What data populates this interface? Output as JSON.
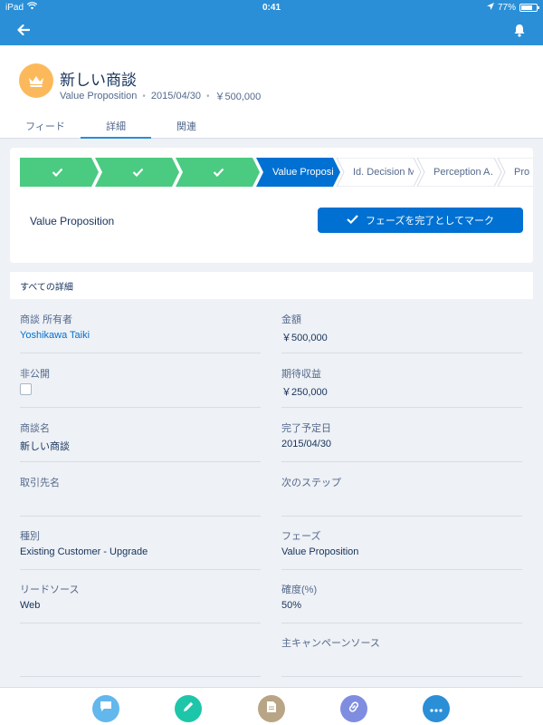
{
  "status_bar": {
    "device": "iPad",
    "time": "0:41",
    "battery": "77%",
    "battery_level": 0.77
  },
  "nav": {
    "back_icon": "arrow-left-icon",
    "bell_icon": "bell-icon"
  },
  "record": {
    "icon": "crown-icon",
    "icon_color": "#fcb95b",
    "title": "新しい商談",
    "stage": "Value Proposition",
    "close_date": "2015/04/30",
    "amount": "￥500,000"
  },
  "tabs": [
    {
      "label": "フィード",
      "active": false
    },
    {
      "label": "詳細",
      "active": true
    },
    {
      "label": "関連",
      "active": false
    }
  ],
  "path": {
    "stages": [
      {
        "label": "",
        "state": "complete"
      },
      {
        "label": "",
        "state": "complete"
      },
      {
        "label": "",
        "state": "complete"
      },
      {
        "label": "Value Proposi…",
        "state": "current"
      },
      {
        "label": "Id. Decision M…",
        "state": "incomplete"
      },
      {
        "label": "Perception A…",
        "state": "incomplete"
      },
      {
        "label": "Pro",
        "state": "incomplete"
      }
    ],
    "colors": {
      "complete": "#4bca81",
      "current": "#0070d2",
      "incomplete": "#ffffff"
    },
    "current_stage_name": "Value Proposition",
    "mark_button_label": "フェーズを完了としてマーク"
  },
  "details": {
    "section_title": "すべての詳細",
    "owner_label": "商談 所有者",
    "owner_value": "Yoshikawa Taiki",
    "amount_label": "金額",
    "amount_value": "￥500,000",
    "private_label": "非公開",
    "expected_label": "期待収益",
    "expected_value": "￥250,000",
    "name_label": "商談名",
    "name_value": "新しい商談",
    "close_label": "完了予定日",
    "close_value": "2015/04/30",
    "account_label": "取引先名",
    "account_value": "",
    "next_step_label": "次のステップ",
    "next_step_value": "",
    "type_label": "種別",
    "type_value": "Existing Customer - Upgrade",
    "stage_label": "フェーズ",
    "stage_value": "Value Proposition",
    "lead_label": "リードソース",
    "lead_value": "Web",
    "prob_label": "確度(%)",
    "prob_value": "50%",
    "campaign_label": "主キャンペーンソース",
    "campaign_value": ""
  },
  "bottom_actions": [
    {
      "name": "post-button",
      "icon": "chat-icon",
      "color": "#62b7ed"
    },
    {
      "name": "edit-button",
      "icon": "pencil-icon",
      "color": "#1ec6a9"
    },
    {
      "name": "note-button",
      "icon": "document-icon",
      "color": "#b8a585"
    },
    {
      "name": "link-button",
      "icon": "link-icon",
      "color": "#7f8de1"
    },
    {
      "name": "more-button",
      "icon": "more-icon",
      "color": "#2a8fd7"
    }
  ]
}
